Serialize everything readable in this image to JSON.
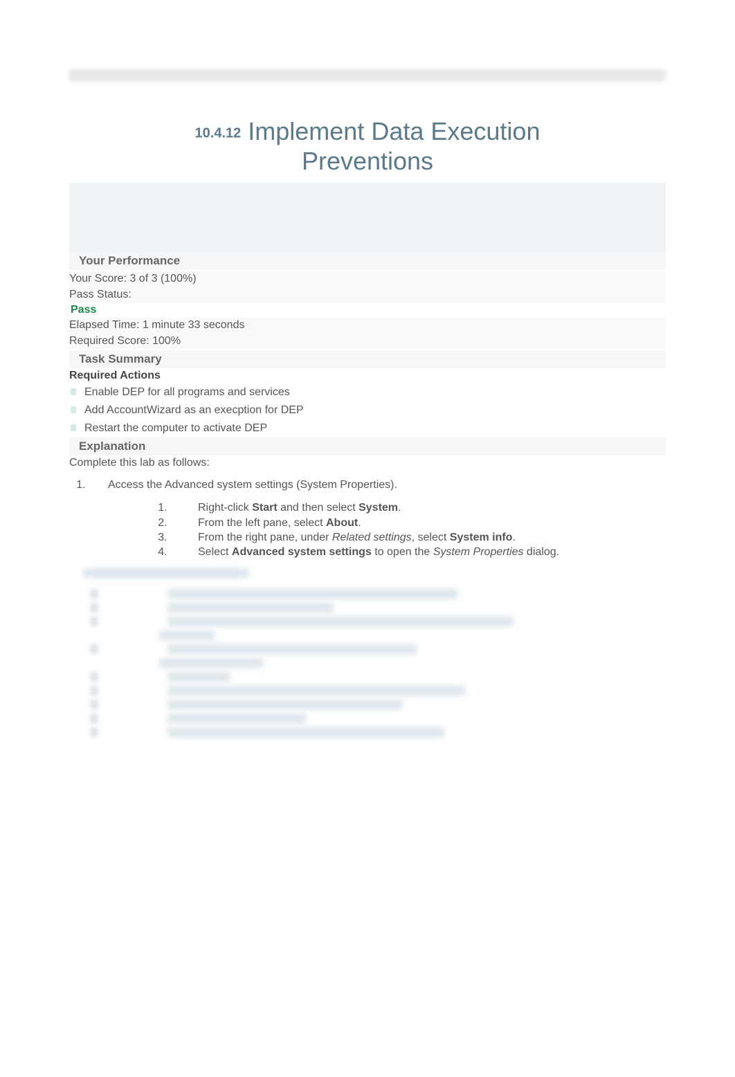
{
  "title": {
    "number": "10.4.12",
    "main_line1": "Implement Data Execution",
    "main_line2": "Preventions"
  },
  "performance": {
    "header": "Your Performance",
    "score_line": "Your Score: 3 of 3 (100%)",
    "pass_status_label": "Pass Status:",
    "pass_status_value": "Pass",
    "elapsed": "Elapsed Time: 1 minute 33 seconds",
    "required_score": "Required Score: 100%"
  },
  "task_summary": {
    "header": "Task Summary",
    "required_actions_label": "Required Actions",
    "actions": [
      "Enable DEP for all programs and services",
      "Add AccountWizard as an execption for DEP",
      "Restart the computer to activate DEP"
    ]
  },
  "explanation": {
    "header": "Explanation",
    "intro": "Complete this lab as follows:",
    "step1": {
      "text": "Access the Advanced system settings (System Properties).",
      "substeps": {
        "s1_pre": "Right-click ",
        "s1_b1": "Start",
        "s1_mid": " and then select ",
        "s1_b2": "System",
        "s1_end": ".",
        "s2_pre": "From the left pane, select ",
        "s2_b1": "About",
        "s2_end": ".",
        "s3_pre": "From the right pane, under ",
        "s3_i1": "Related settings",
        "s3_mid": ", select ",
        "s3_b1": "System info",
        "s3_end": ".",
        "s4_pre": "Select ",
        "s4_b1": "Advanced system settings",
        "s4_mid": " to open the ",
        "s4_i1": "System Properties",
        "s4_end": " dialog."
      }
    }
  }
}
